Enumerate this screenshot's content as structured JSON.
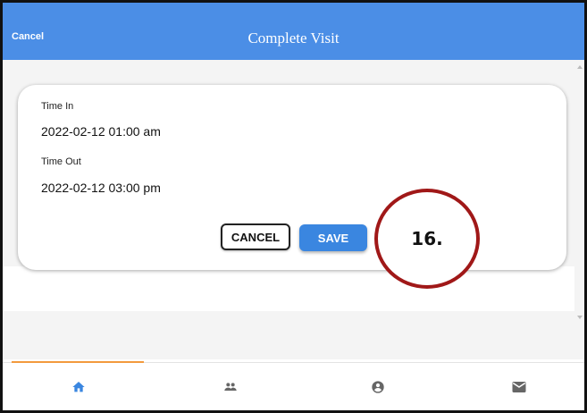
{
  "header": {
    "cancel_label": "Cancel",
    "title": "Complete Visit"
  },
  "form": {
    "time_in_label": "Time In",
    "time_in_value": "2022-02-12 01:00 am",
    "time_out_label": "Time Out",
    "time_out_value": "2022-02-12 03:00 pm",
    "cancel_button": "CANCEL",
    "save_button": "SAVE"
  },
  "annotation": {
    "label": "16."
  },
  "bottom_nav": {
    "active": "home",
    "items": [
      {
        "icon": "home-icon"
      },
      {
        "icon": "people-icon"
      },
      {
        "icon": "account-icon"
      },
      {
        "icon": "mail-icon"
      }
    ]
  },
  "colors": {
    "header": "#4b8ee6",
    "save": "#3a86e0",
    "nav_active": "#3a86e0",
    "nav_inactive": "#666666",
    "indicator": "#f39a3d",
    "annotation_ring": "#a01818"
  }
}
